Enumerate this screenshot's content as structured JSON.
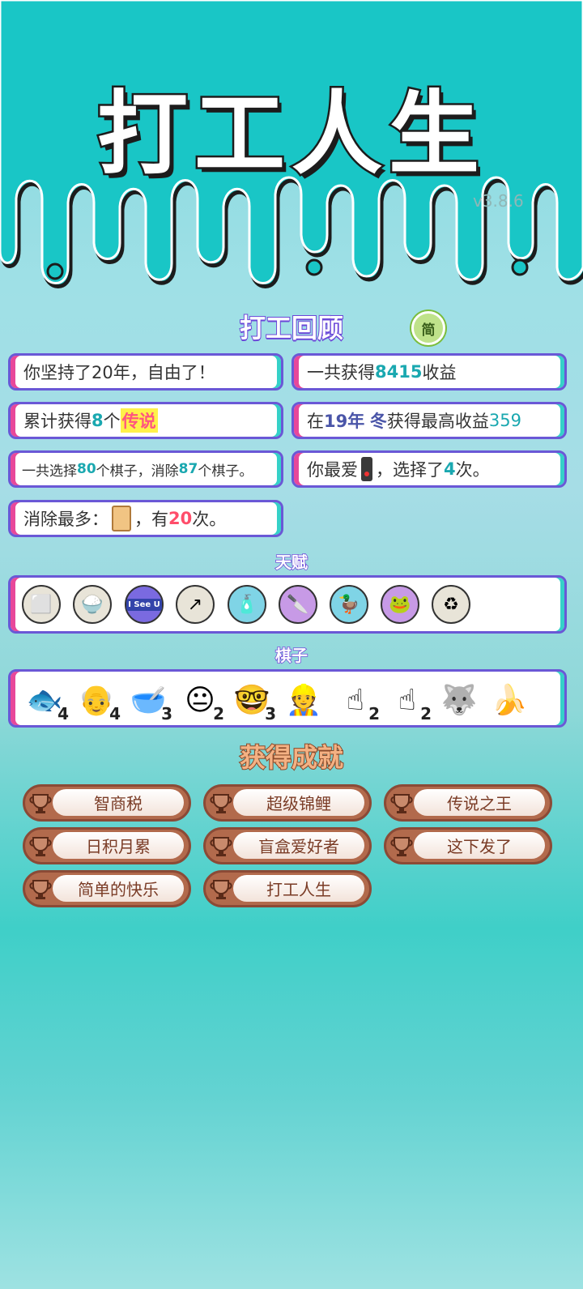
{
  "header": {
    "title": "打工人生",
    "version": "v3.8.6"
  },
  "review": {
    "title": "打工回顾",
    "mode_badge": "简",
    "stats": {
      "years_pre": "你坚持了",
      "years": "20年",
      "years_post": "，自由了！",
      "total_pre": "一共获得",
      "total_income": "8415",
      "total_post": "收益",
      "legend_pre": "累计获得",
      "legend_count": "8",
      "legend_mid": "个",
      "legend_word": "传说",
      "best_pre": "在 ",
      "best_year": "19年",
      "best_season": "冬",
      "best_mid": " 获得最高收益",
      "best_income": "359",
      "chose_pre": "一共选择",
      "chose_count": "80",
      "chose_mid": "个棋子，消除",
      "removed_count": "87",
      "chose_post": "个棋子。",
      "fav_pre": "你最爱",
      "fav_mid": "，选择了",
      "fav_count": "4",
      "fav_post": "次。",
      "most_pre": "消除最多：",
      "most_mid": "，有",
      "most_count": "20",
      "most_post": "次。"
    }
  },
  "talents": {
    "title": "天赋",
    "items": [
      "sugar-cubes-icon",
      "rice-bowl-icon",
      "i-see-u-card-icon",
      "arrow-up-card-icon",
      "bottle-icon",
      "cleaver-icon",
      "duck-pot-icon",
      "frog-flowers-icon",
      "recycle-icon"
    ],
    "i_see_u_label": "I See U"
  },
  "pieces": {
    "title": "棋子",
    "items": [
      {
        "icon": "koi-fish-icon",
        "count": "4"
      },
      {
        "icon": "grandpa-icon",
        "count": "4"
      },
      {
        "icon": "empty-bowl-icon",
        "count": "3"
      },
      {
        "icon": "yellow-face-icon",
        "count": "2"
      },
      {
        "icon": "glasses-man-icon",
        "count": "3"
      },
      {
        "icon": "old-worker-icon",
        "count": ""
      },
      {
        "icon": "brown-finger-icon",
        "count": "2"
      },
      {
        "icon": "gray-finger-icon",
        "count": "2"
      },
      {
        "icon": "husky-king-icon",
        "count": ""
      },
      {
        "icon": "banana-icon",
        "count": ""
      }
    ]
  },
  "achievements": {
    "title": "获得成就",
    "items": [
      "智商税",
      "超级锦鲤",
      "传说之王",
      "日积月累",
      "盲盒爱好者",
      "这下发了",
      "简单的快乐",
      "打工人生"
    ]
  },
  "colors": {
    "card_border": "#6a58d6",
    "left_accent": "#e8489a",
    "right_accent": "#35d1c8",
    "trophy": "#b26a4c"
  }
}
